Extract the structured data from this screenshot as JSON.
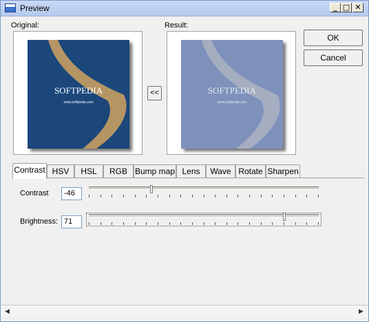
{
  "window": {
    "title": "Preview"
  },
  "controls": {
    "minimize": "_",
    "maximize": "□",
    "close": "✕"
  },
  "labels": {
    "original": "Original:",
    "result": "Result:"
  },
  "images": {
    "watermark": "SOFTPEDIA",
    "subtitle": "www.softpedia.com",
    "original_colors": {
      "sea": "#1e4f86",
      "sand": "#b69564",
      "dark": "#0b1f3e"
    },
    "result_colors": {
      "sea": "#7f93bc",
      "sand": "#a5adc0",
      "dark": "#6c7fa8"
    }
  },
  "buttons": {
    "ok": "OK",
    "cancel": "Cancel",
    "copy_back": "<<"
  },
  "tabs": [
    {
      "label": "Contrast",
      "active": true
    },
    {
      "label": "HSV",
      "active": false
    },
    {
      "label": "HSL",
      "active": false
    },
    {
      "label": "RGB",
      "active": false
    },
    {
      "label": "Bump map",
      "active": false
    },
    {
      "label": "Lens",
      "active": false
    },
    {
      "label": "Wave",
      "active": false
    },
    {
      "label": "Rotate",
      "active": false
    },
    {
      "label": "Sharpen",
      "active": false
    }
  ],
  "settings": {
    "contrast": {
      "label": "Contrast",
      "value": "-46",
      "min": -100,
      "max": 100
    },
    "brightness": {
      "label": "Brightness:",
      "value": "71",
      "min": -100,
      "max": 100
    }
  },
  "scrollbar": {
    "left_arrow": "◀",
    "right_arrow": "▶"
  }
}
